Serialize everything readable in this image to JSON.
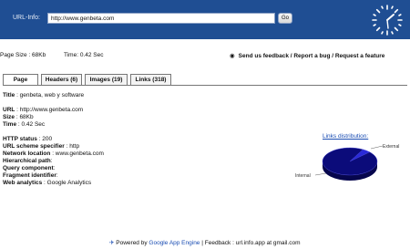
{
  "header": {
    "url_label": "URL-Info:",
    "url_value": "http://www.genbeta.com",
    "go_label": "Go"
  },
  "info_bar": {
    "page_size": "Page Size : 68Kb",
    "time": "Time: 0.42 Sec",
    "feedback": "Send us feedback / Report a bug / Request a feature"
  },
  "tabs": [
    {
      "label": "Page",
      "active": true
    },
    {
      "label": "Headers (6)",
      "active": false
    },
    {
      "label": "Images (19)",
      "active": false
    },
    {
      "label": "Links (318)",
      "active": false
    }
  ],
  "page": {
    "title_label": "Title",
    "title_value": ": genbeta, web y software",
    "url_label": "URL",
    "url_value": ": http://www.genbeta.com",
    "size_label": "Size",
    "size_value": ": 68Kb",
    "time_label": "Time",
    "time_value": ": 0.42 Sec",
    "http_status_label": "HTTP status",
    "http_status_value": ": 200",
    "scheme_label": "URL scheme specifier",
    "scheme_value": ": http",
    "network_label": "Network location",
    "network_value": ": www.genbeta.com",
    "path_label": "Hierarchical path",
    "path_value": ":",
    "query_label": "Query component",
    "query_value": ":",
    "fragment_label": "Fragment identifier",
    "fragment_value": ":",
    "analytics_label": "Web analytics",
    "analytics_value": ": Google Analytics"
  },
  "chart_data": {
    "type": "pie",
    "title": "Links distribution:",
    "slices": [
      {
        "name": "External",
        "value": 5
      },
      {
        "name": "Internal",
        "value": 95
      }
    ],
    "colors": [
      "#2a2ad8",
      "#0b0b7a"
    ]
  },
  "footer": {
    "powered_by": "Powered by",
    "engine": "Google App Engine",
    "feedback": "| Feedback : url.info.app at gmail.com"
  }
}
